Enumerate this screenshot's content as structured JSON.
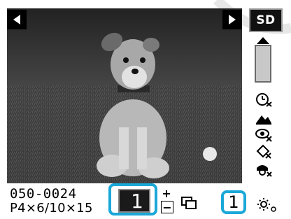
{
  "storage": {
    "card_label": "SD"
  },
  "photo": {
    "file_number": "050-0024",
    "paper_size": "P4×6/10×15"
  },
  "print": {
    "copies": "1",
    "total": "1",
    "plus_label": "+",
    "minus_label": "−"
  },
  "colors": {
    "highlight": "#1aa8d8",
    "background": "#ffffff",
    "display": "#1a1a1a"
  },
  "icons": {
    "nav_prev": "triangle-left-icon",
    "nav_next": "triangle-right-icon",
    "scroll_up": "triangle-up-icon",
    "side": [
      "timer-icon",
      "landscape-icon",
      "red-eye-icon",
      "rotate-icon",
      "face-icon",
      "brightness-icon"
    ]
  }
}
